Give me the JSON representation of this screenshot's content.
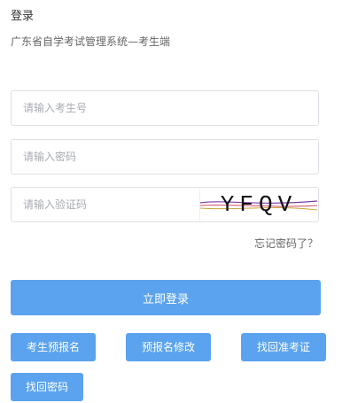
{
  "header": {
    "title": "登录",
    "subtitle": "广东省自学考试管理系统—考生端"
  },
  "form": {
    "exam_no_placeholder": "请输入考生号",
    "password_placeholder": "请输入密码",
    "captcha_placeholder": "请输入验证码",
    "captcha_text": "YFQV",
    "forgot_label": "忘记密码了？"
  },
  "buttons": {
    "login": "立即登录",
    "pre_register": "考生预报名",
    "edit_pre_register": "预报名修改",
    "recover_admission": "找回准考证",
    "recover_password": "找回密码"
  },
  "colors": {
    "primary": "#5ba3ee",
    "border": "#dcdfe6",
    "placeholder": "#a8abb2"
  }
}
